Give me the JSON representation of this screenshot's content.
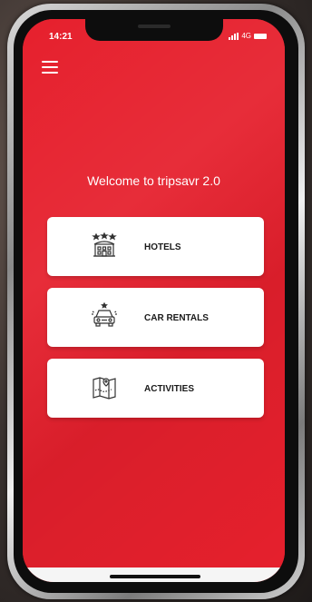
{
  "status_bar": {
    "time": "14:21",
    "network": "4G"
  },
  "welcome_text": "Welcome to tripsavr 2.0",
  "menu": [
    {
      "id": "hotels",
      "label": "HOTELS",
      "icon": "hotel-icon"
    },
    {
      "id": "car-rentals",
      "label": "CAR RENTALS",
      "icon": "car-icon"
    },
    {
      "id": "activities",
      "label": "ACTIVITIES",
      "icon": "map-icon"
    }
  ],
  "colors": {
    "brand_red": "#e6202d",
    "card_bg": "#ffffff",
    "text_dark": "#1a1a1a"
  }
}
